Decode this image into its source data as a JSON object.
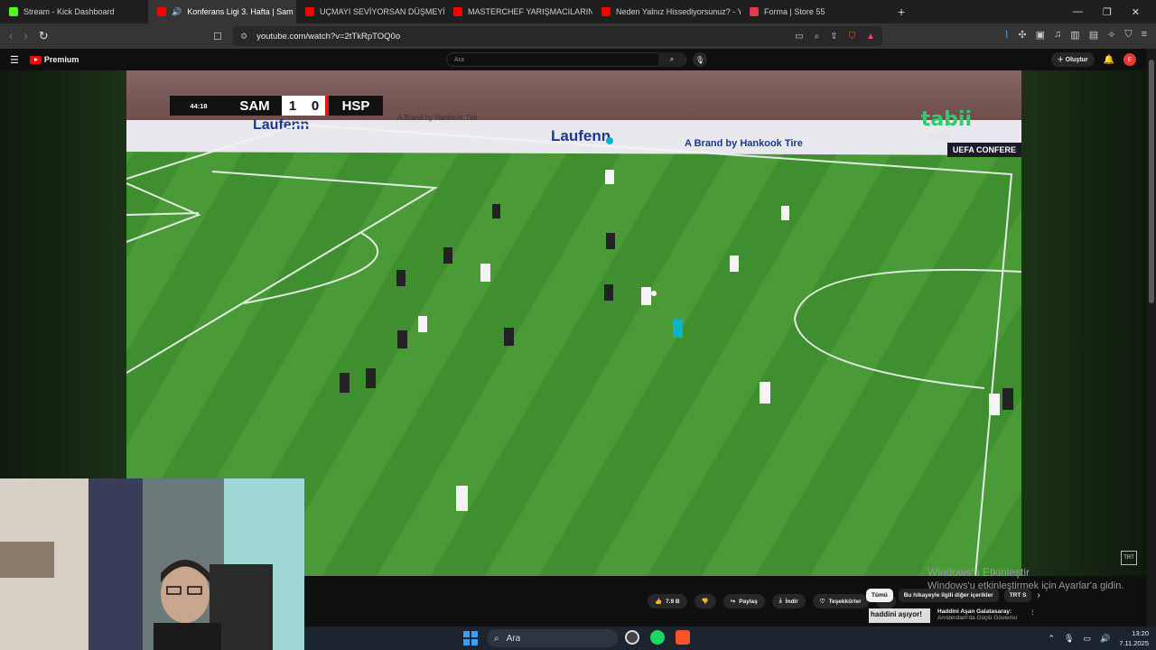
{
  "browser": {
    "tabs": [
      {
        "label": "Stream - Kick Dashboard",
        "color": "#53fc18"
      },
      {
        "label": "Konferans Ligi 3. Hafta | Sam",
        "color": "#ff0000",
        "active": true
      },
      {
        "label": "UÇMAYI SEVİYORSAN DÜŞMEYİ DE B",
        "color": "#ff0000"
      },
      {
        "label": "MASTERCHEF YARIŞMACILARININ RE",
        "color": "#ff0000"
      },
      {
        "label": "Neden Yalnız Hissediyorsunuz? - You",
        "color": "#ff0000"
      },
      {
        "label": "Forma | Store 55",
        "color": "#e53950"
      }
    ],
    "new_tab": "+",
    "url": "youtube.com/watch?v=2tTkRpTOQ0o"
  },
  "youtube": {
    "logo_text": "Premium",
    "search_placeholder": "Ara",
    "create_label": "Oluştur",
    "avatar_letter": "E"
  },
  "video": {
    "scoreboard": {
      "clock": "44:18",
      "home": "SAM",
      "home_score": "1",
      "away_score": "0",
      "away": "HSP"
    },
    "broadcaster": "tabii",
    "broadcaster_sub": "sport",
    "competition": "UEFA CONFERE",
    "ad1": "Laufenn",
    "ad2": "A Brand by Hankook Tire",
    "corner_logo": "TRT"
  },
  "actions": {
    "like_count": "7.9 B",
    "share": "Paylaş",
    "download": "İndir",
    "thanks": "Teşekkürler",
    "more": "···"
  },
  "chips": [
    "Tümü",
    "Bu hikayeyle ilgili diğer içerikler",
    "TRT S"
  ],
  "related": {
    "thumb_text": "haddini aşıyor!",
    "title": "Haddini Aşan Galatasaray:",
    "subtitle": "Amsterdam'da Güçlü Gösterisi"
  },
  "watermark": {
    "line1": "Windows'u Etkinleştir",
    "line2": "Windows'u etkinleştirmek için Ayarlar'a gidin."
  },
  "taskbar": {
    "search_label": "Ara",
    "time": "13:20",
    "date": "7.11.2025"
  }
}
